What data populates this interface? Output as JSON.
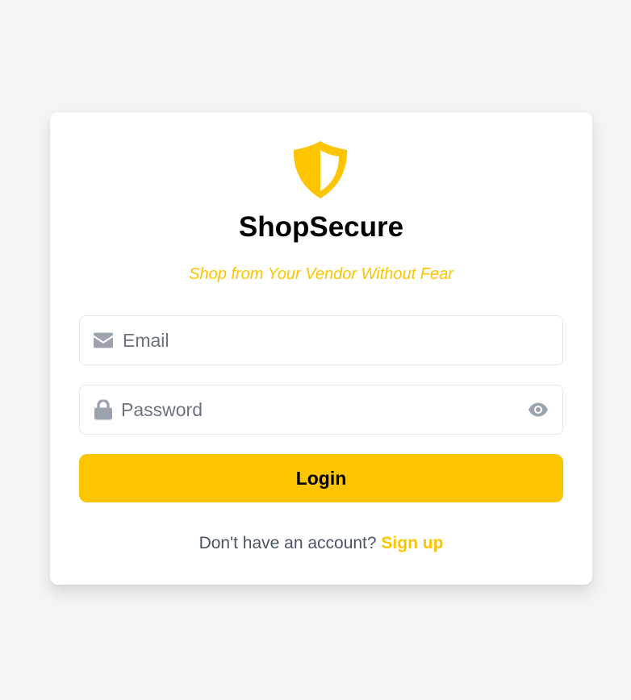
{
  "brand": {
    "name": "ShopSecure",
    "tagline": "Shop from Your Vendor Without Fear",
    "logo_icon": "shield-icon",
    "accent_color": "#fcc500"
  },
  "form": {
    "email": {
      "placeholder": "Email",
      "value": "",
      "icon": "envelope-icon"
    },
    "password": {
      "placeholder": "Password",
      "value": "",
      "icon": "lock-icon",
      "toggle_icon": "eye-icon"
    },
    "login_label": "Login"
  },
  "signup": {
    "prompt": "Don't have an account?",
    "link_label": "Sign up"
  }
}
